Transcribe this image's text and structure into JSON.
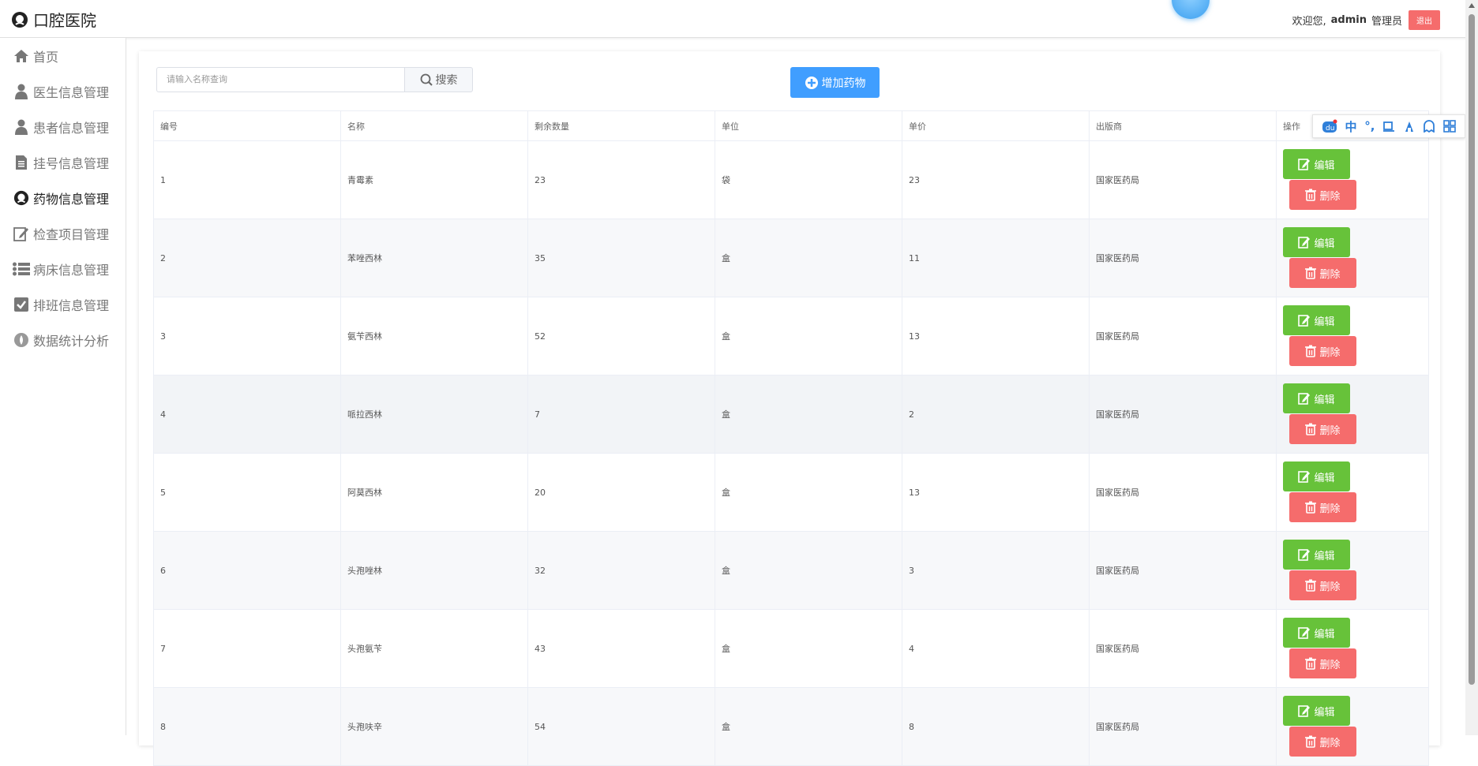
{
  "header": {
    "app_title": "口腔医院",
    "welcome": "欢迎您,",
    "username": "admin",
    "role": "管理员",
    "logout_label": "退出"
  },
  "sidebar": {
    "items": [
      {
        "label": "首页",
        "icon": "home-icon"
      },
      {
        "label": "医生信息管理",
        "icon": "user-icon"
      },
      {
        "label": "患者信息管理",
        "icon": "user-icon"
      },
      {
        "label": "挂号信息管理",
        "icon": "document-icon"
      },
      {
        "label": "药物信息管理",
        "icon": "medicine-icon",
        "active": true
      },
      {
        "label": "检查项目管理",
        "icon": "edit-icon"
      },
      {
        "label": "病床信息管理",
        "icon": "list-icon"
      },
      {
        "label": "排班信息管理",
        "icon": "checkbox-icon"
      },
      {
        "label": "数据统计分析",
        "icon": "drop-icon"
      }
    ]
  },
  "search": {
    "placeholder": "请输入名称查询",
    "button_label": "搜索"
  },
  "toolbar": {
    "add_label": "增加药物"
  },
  "table": {
    "columns": [
      "编号",
      "名称",
      "剩余数量",
      "单位",
      "单价",
      "出版商",
      "操作"
    ],
    "edit_label": "编辑",
    "delete_label": "删除",
    "rows": [
      {
        "id": "1",
        "name": "青霉素",
        "qty": "23",
        "unit": "袋",
        "price": "23",
        "vendor": "国家医药局"
      },
      {
        "id": "2",
        "name": "苯唑西林",
        "qty": "35",
        "unit": "盒",
        "price": "11",
        "vendor": "国家医药局"
      },
      {
        "id": "3",
        "name": "氨苄西林",
        "qty": "52",
        "unit": "盒",
        "price": "13",
        "vendor": "国家医药局"
      },
      {
        "id": "4",
        "name": "哌拉西林",
        "qty": "7",
        "unit": "盒",
        "price": "2",
        "vendor": "国家医药局"
      },
      {
        "id": "5",
        "name": "阿莫西林",
        "qty": "20",
        "unit": "盒",
        "price": "13",
        "vendor": "国家医药局"
      },
      {
        "id": "6",
        "name": "头孢唑林",
        "qty": "32",
        "unit": "盒",
        "price": "3",
        "vendor": "国家医药局"
      },
      {
        "id": "7",
        "name": "头孢氨苄",
        "qty": "43",
        "unit": "盒",
        "price": "4",
        "vendor": "国家医药局"
      },
      {
        "id": "8",
        "name": "头孢呋辛",
        "qty": "54",
        "unit": "盒",
        "price": "8",
        "vendor": "国家医药局"
      }
    ]
  },
  "ime_toolbar": {
    "mode_label": "中",
    "punct_label": "°,"
  },
  "colors": {
    "primary": "#409eff",
    "success": "#67c23a",
    "danger": "#f56c6c"
  }
}
